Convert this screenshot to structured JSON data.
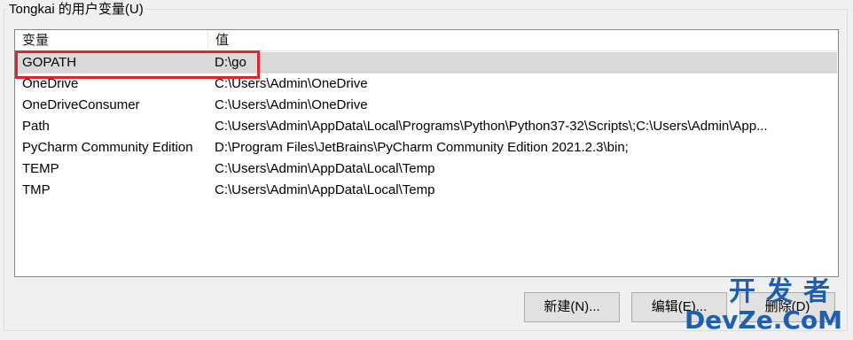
{
  "groupbox": {
    "title": "Tongkai 的用户变量(U)"
  },
  "table": {
    "headers": {
      "name": "变量",
      "value": "值"
    },
    "rows": [
      {
        "name": "GOPATH",
        "value": "D:\\go"
      },
      {
        "name": "OneDrive",
        "value": "C:\\Users\\Admin\\OneDrive"
      },
      {
        "name": "OneDriveConsumer",
        "value": "C:\\Users\\Admin\\OneDrive"
      },
      {
        "name": "Path",
        "value": "C:\\Users\\Admin\\AppData\\Local\\Programs\\Python\\Python37-32\\Scripts\\;C:\\Users\\Admin\\App..."
      },
      {
        "name": "PyCharm Community Edition",
        "value": "D:\\Program Files\\JetBrains\\PyCharm Community Edition 2021.2.3\\bin;"
      },
      {
        "name": "TEMP",
        "value": "C:\\Users\\Admin\\AppData\\Local\\Temp"
      },
      {
        "name": "TMP",
        "value": "C:\\Users\\Admin\\AppData\\Local\\Temp"
      }
    ],
    "selected_row": "GOPATH"
  },
  "buttons": {
    "new_label": "新建(N)...",
    "edit_label": "编辑(E)...",
    "delete_label": "删除(D)"
  },
  "watermark": {
    "line1": "开发者",
    "line2": "DevZe.CoM"
  },
  "colors": {
    "highlight": "#e0262b",
    "selection": "#d9d9d9",
    "watermark": "#1f5fb0"
  }
}
